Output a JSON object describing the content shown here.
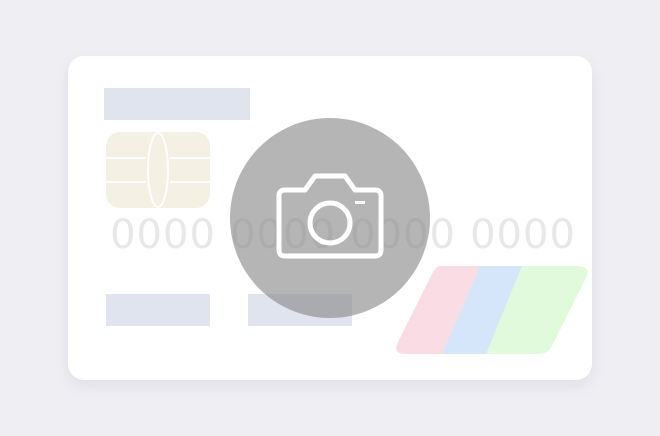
{
  "card": {
    "number_groups": [
      "0000",
      "0000",
      "0000",
      "0000"
    ]
  },
  "colors": {
    "background": "#eeeef3",
    "card": "#ffffff",
    "placeholder": "#e0e4ef",
    "chip": "#f4f0e3",
    "stripe_pink": "#fadde4",
    "stripe_blue": "#d6e6fa",
    "stripe_green": "#e1fadb",
    "overlay": "rgba(135,135,135,0.62)"
  },
  "icons": {
    "overlay_icon": "camera-icon",
    "chip_icon": "card-chip-icon",
    "brand_icon": "card-brand-stripes-icon"
  }
}
